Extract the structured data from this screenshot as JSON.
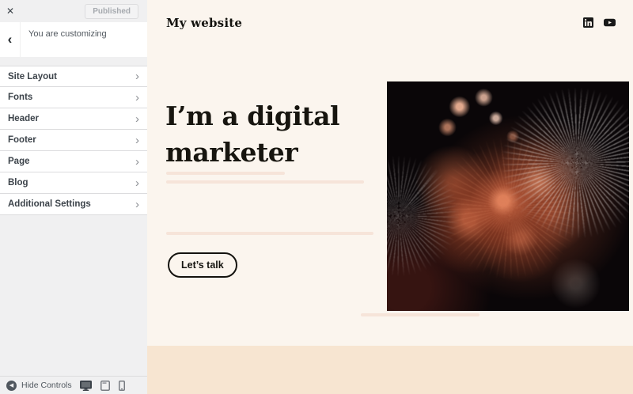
{
  "customizer": {
    "close_icon": "✕",
    "publish_button_label": "Published",
    "back_icon": "‹",
    "panel_title": "You are customizing",
    "chevron_icon": "›",
    "menu_items": [
      {
        "label": "Site Layout"
      },
      {
        "label": "Fonts"
      },
      {
        "label": "Header"
      },
      {
        "label": "Footer"
      },
      {
        "label": "Page"
      },
      {
        "label": "Blog"
      },
      {
        "label": "Additional Settings"
      }
    ],
    "footer": {
      "collapse_icon": "◀",
      "hide_controls_label": "Hide Controls",
      "devices": [
        "desktop",
        "tablet",
        "mobile"
      ],
      "active_device": "desktop"
    }
  },
  "site_preview": {
    "site_title": "My website",
    "social_icons": [
      "linkedin-icon",
      "youtube-icon"
    ],
    "hero": {
      "heading": "I’m a digital marketer",
      "cta_label": "Let’s talk",
      "hero_image": "fireworks-photo"
    }
  },
  "colors": {
    "sidebar_background": "#f0f0f1",
    "preview_background": "#fbf5ee",
    "footer_band": "#f7e5d1",
    "heading_text": "#17150f",
    "firework_orange": "#dd7a4e"
  }
}
